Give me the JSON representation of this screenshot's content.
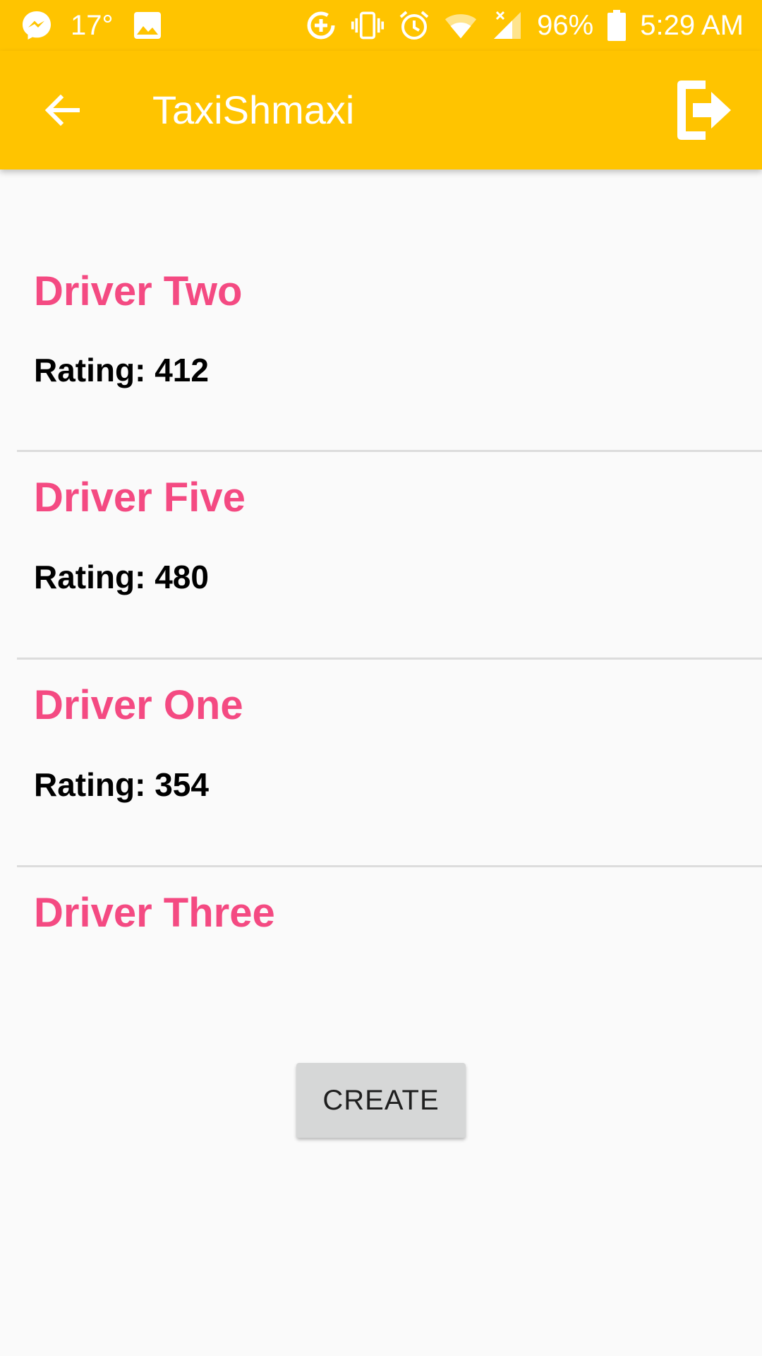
{
  "status_bar": {
    "temperature": "17°",
    "battery": "96%",
    "time": "5:29 AM",
    "icons": [
      "messenger-icon",
      "image-icon",
      "data-saver-icon",
      "vibrate-icon",
      "alarm-icon",
      "wifi-icon",
      "signal-icon",
      "battery-icon"
    ]
  },
  "app_bar": {
    "title": "TaxiShmaxi",
    "back_icon": "arrow-back-icon",
    "logout_icon": "logout-icon",
    "background_color": "#ffc400"
  },
  "drivers": [
    {
      "name": "Driver Two",
      "rating": "Rating: 412"
    },
    {
      "name": "Driver Five",
      "rating": "Rating: 480"
    },
    {
      "name": "Driver One",
      "rating": "Rating: 354"
    },
    {
      "name": "Driver Three"
    }
  ],
  "colors": {
    "driver_name": "#f44a82",
    "accent": "#ffc400"
  },
  "create_button": {
    "label": "CREATE"
  }
}
